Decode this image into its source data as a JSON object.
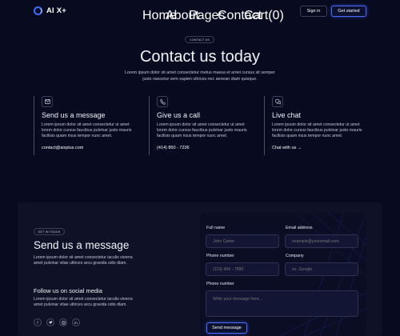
{
  "brand": {
    "name": "AI X+"
  },
  "nav": {
    "links": [
      "Home",
      "About",
      "Pages",
      "Contact",
      "Cart(0)"
    ],
    "sign_in": "Sign in",
    "get_started": "Get started"
  },
  "hero": {
    "badge": "CONTACT US",
    "title": "Contact us today",
    "subtitle": "Lorem ipsum dolor sit amet consectetur metus massa et amet cursus sit semper justo nascetur sem sapien ultrices nec aenean diam quisque."
  },
  "features": [
    {
      "icon": "envelope-icon",
      "title": "Send us a message",
      "text": "Lorem ipsum dolor sit amet consectetur ut amet lorem dolor cursus faucibus pulvinar justo mauris facilisis quam risus tempor nunc amet.",
      "link": "contact@aixplus.com"
    },
    {
      "icon": "phone-icon",
      "title": "Give us a call",
      "text": "Lorem ipsum dolor sit amet consectetur ut amet lorem dolor cursus faucibus pulvinar justo mauris facilisis quam risus tempor nunc amet.",
      "link": "(414) 850 - 7236"
    },
    {
      "icon": "chat-icon",
      "title": "Live chat",
      "text": "Lorem ipsum dolor sit amet consectetur ut amet lorem dolor cursus faucibus pulvinar justo mauris facilisis quam risus tempor nunc amet.",
      "link": "Chat with us",
      "link_arrow": "→"
    }
  ],
  "contact_form": {
    "badge": "GET IN TOUCH",
    "title": "Send us a message",
    "subtitle": "Lorem ipsum dolor sit amet consectetur iaculis viverra amet pulvinar vitae ultrices arcu gravida odio diam.",
    "follow_title": "Follow us on social media",
    "follow_subtitle": "Lorem ipsum dolor sit amet consectetur iaculis viverra amet pulvinar vitae ultrices arcu gravida odio diam.",
    "socials": [
      "facebook-icon",
      "twitter-icon",
      "instagram-icon",
      "linkedin-icon"
    ],
    "fields": {
      "full_name": {
        "label": "Full name",
        "placeholder": "John Carter"
      },
      "email": {
        "label": "Email address",
        "placeholder": "example@youremail.com"
      },
      "phone": {
        "label": "Phone number",
        "placeholder": "(123) 456 - 7890"
      },
      "company": {
        "label": "Company",
        "placeholder": "ex. Google"
      },
      "message": {
        "label": "Phone number",
        "placeholder": "Write your message here..."
      }
    },
    "send": "Send message"
  },
  "colors": {
    "background": "#080a1f",
    "panel": "#0f1226",
    "accent": "#4a6cff"
  }
}
